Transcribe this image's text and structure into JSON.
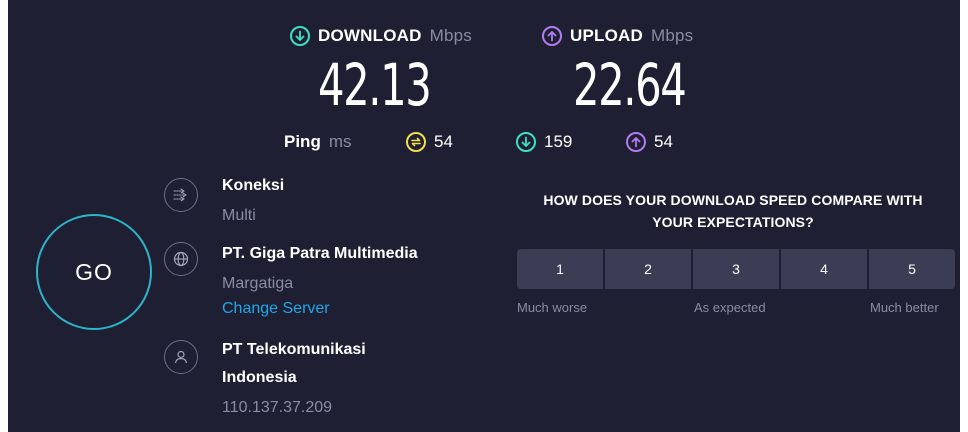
{
  "download": {
    "label": "DOWNLOAD",
    "unit": "Mbps",
    "value": "42.13",
    "color": "#3fe0c5"
  },
  "upload": {
    "label": "UPLOAD",
    "unit": "Mbps",
    "value": "22.64",
    "color": "#b27bf1"
  },
  "ping": {
    "label": "Ping",
    "unit": "ms",
    "idle": "54",
    "download": "159",
    "upload": "54",
    "idle_color": "#f3e04a"
  },
  "connection": {
    "title": "Koneksi",
    "value": "Multi"
  },
  "server": {
    "name": "PT. Giga Patra Multimedia",
    "location": "Margatiga",
    "change_label": "Change Server"
  },
  "provider": {
    "name_line1": "PT Telekomunikasi",
    "name_line2": "Indonesia",
    "ip": "110.137.37.209"
  },
  "go_button": {
    "label": "GO",
    "ring_color": "#2bb5c9"
  },
  "survey": {
    "question_line1": "HOW DOES YOUR DOWNLOAD SPEED COMPARE WITH",
    "question_line2": "YOUR EXPECTATIONS?",
    "ratings": [
      "1",
      "2",
      "3",
      "4",
      "5"
    ],
    "scale_low": "Much worse",
    "scale_mid": "As expected",
    "scale_high": "Much better"
  }
}
